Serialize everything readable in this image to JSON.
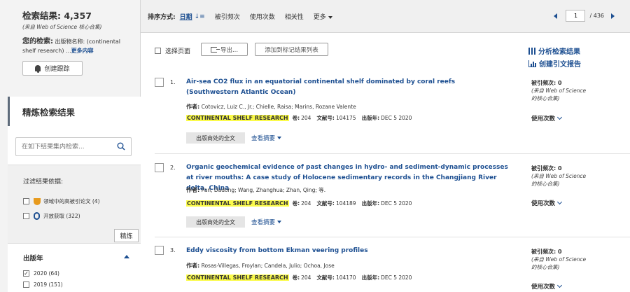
{
  "sidebar": {
    "results_title": "检索结果: 4,357",
    "results_source": "(来自 Web of Science 核心合集)",
    "query_label": "您的检索:",
    "query_field": "出版物名称:",
    "query_text": "(continental shelf research)",
    "query_ellipsis": "...",
    "query_more": "更多内容",
    "alert_button": "创建跟踪",
    "refine_title": "精炼检索结果",
    "search_placeholder": "在如下结果集内检索...",
    "filter_title": "过滤结果依据:",
    "filters": [
      {
        "label": "领域中的高被引论文 (4)",
        "checked": false,
        "icon": "trophy-icon"
      },
      {
        "label": "开放获取 (322)",
        "checked": false,
        "icon": "open-access-icon"
      }
    ],
    "refine_button": "精炼",
    "year_title": "出版年",
    "years": [
      {
        "label": "2020 (64)",
        "checked": true
      },
      {
        "label": "2019 (151)",
        "checked": false
      }
    ]
  },
  "topbar": {
    "sort_label": "排序方式:",
    "sort_active": "日期",
    "sort_options": [
      "被引频次",
      "使用次数",
      "相关性"
    ],
    "sort_more": "更多",
    "page_current": "1",
    "page_total": "/ 436"
  },
  "actions": {
    "select_page": "选择页面",
    "export": "导出...",
    "add_marked": "添加到标记结果列表",
    "analyze": "分析检索结果",
    "citation_report": "创建引文报告"
  },
  "labels": {
    "authors": "作者:",
    "volume": "卷:",
    "article_no": "文献号:",
    "pub_year": "出版年:",
    "fulltext": "出版商处的全文",
    "abstract": "查看摘要",
    "cites": "被引频次:",
    "cites_source": "(来自 Web of Science 的核心合集)",
    "usage": "使用次数"
  },
  "records": [
    {
      "num": "1.",
      "title": "Air-sea CO2 flux in an equatorial continental shelf dominated by coral reefs (Southwestern Atlantic Ocean)",
      "authors": "Cotovicz, Luiz C., Jr.; Chielle, Raisa; Marins, Rozane Valente",
      "journal": "CONTINENTAL SHELF RESEARCH",
      "volume": "204",
      "article_no": "104175",
      "pub_year": "DEC 5 2020",
      "cites": "0"
    },
    {
      "num": "2.",
      "title": "Organic geochemical evidence of past changes in hydro- and sediment-dynamic processes at river mouths: A case study of Holocene sedimentary records in the Changjiang River delta, China",
      "authors": "Pan, Dadong; Wang, Zhanghua; Zhan, Qing; 等.",
      "journal": "CONTINENTAL SHELF RESEARCH",
      "volume": "204",
      "article_no": "104189",
      "pub_year": "DEC 5 2020",
      "cites": "0"
    },
    {
      "num": "3.",
      "title": "Eddy viscosity from bottom Ekman veering profiles",
      "authors": "Rosas-Villegas, Froylan; Candela, Julio; Ochoa, Jose",
      "journal": "CONTINENTAL SHELF RESEARCH",
      "volume": "204",
      "article_no": "104170",
      "pub_year": "DEC 5 2020",
      "cites": "0"
    }
  ]
}
